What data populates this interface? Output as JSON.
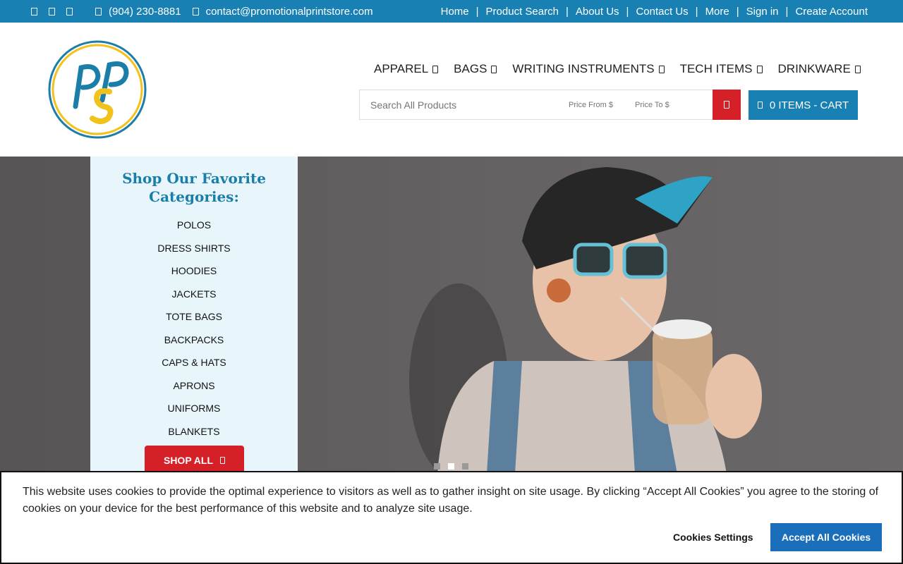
{
  "topbar": {
    "phone": "(904) 230-8881",
    "email": "contact@promotionalprintstore.com",
    "social_icons": [
      "facebook-icon",
      "twitter-icon",
      "instagram-icon"
    ],
    "links": [
      "Home",
      "Product Search",
      "About Us",
      "Contact Us",
      "More",
      "Sign in",
      "Create Account"
    ],
    "separator": "|"
  },
  "nav": {
    "items": [
      "APPAREL",
      "BAGS",
      "WRITING INSTRUMENTS",
      "TECH ITEMS",
      "DRINKWARE"
    ]
  },
  "search": {
    "placeholder": "Search All Products",
    "price_from_placeholder": "Price From $",
    "price_to_placeholder": "Price To $"
  },
  "cart": {
    "label": "0 ITEMS - CART"
  },
  "categories": {
    "title": "Shop Our Favorite Categories:",
    "items": [
      "POLOS",
      "DRESS SHIRTS",
      "HOODIES",
      "JACKETS",
      "TOTE BAGS",
      "BACKPACKS",
      "CAPS & HATS",
      "APRONS",
      "UNIFORMS",
      "BLANKETS"
    ],
    "shop_all": "SHOP ALL"
  },
  "slider": {
    "dot_count": 3,
    "active_dot": 2
  },
  "cookie": {
    "text": "This website uses cookies to provide the optimal experience to visitors as well as to gather insight on site usage. By clicking “Accept All Cookies” you agree to the storing of cookies on your device for the best performance of this website and to analyze site usage.",
    "settings": "Cookies Settings",
    "accept": "Accept All Cookies"
  },
  "colors": {
    "brand_blue": "#1880b3",
    "brand_red": "#d62027",
    "panel_bg": "#e8f6fc",
    "logo_yellow": "#f1c21b"
  }
}
